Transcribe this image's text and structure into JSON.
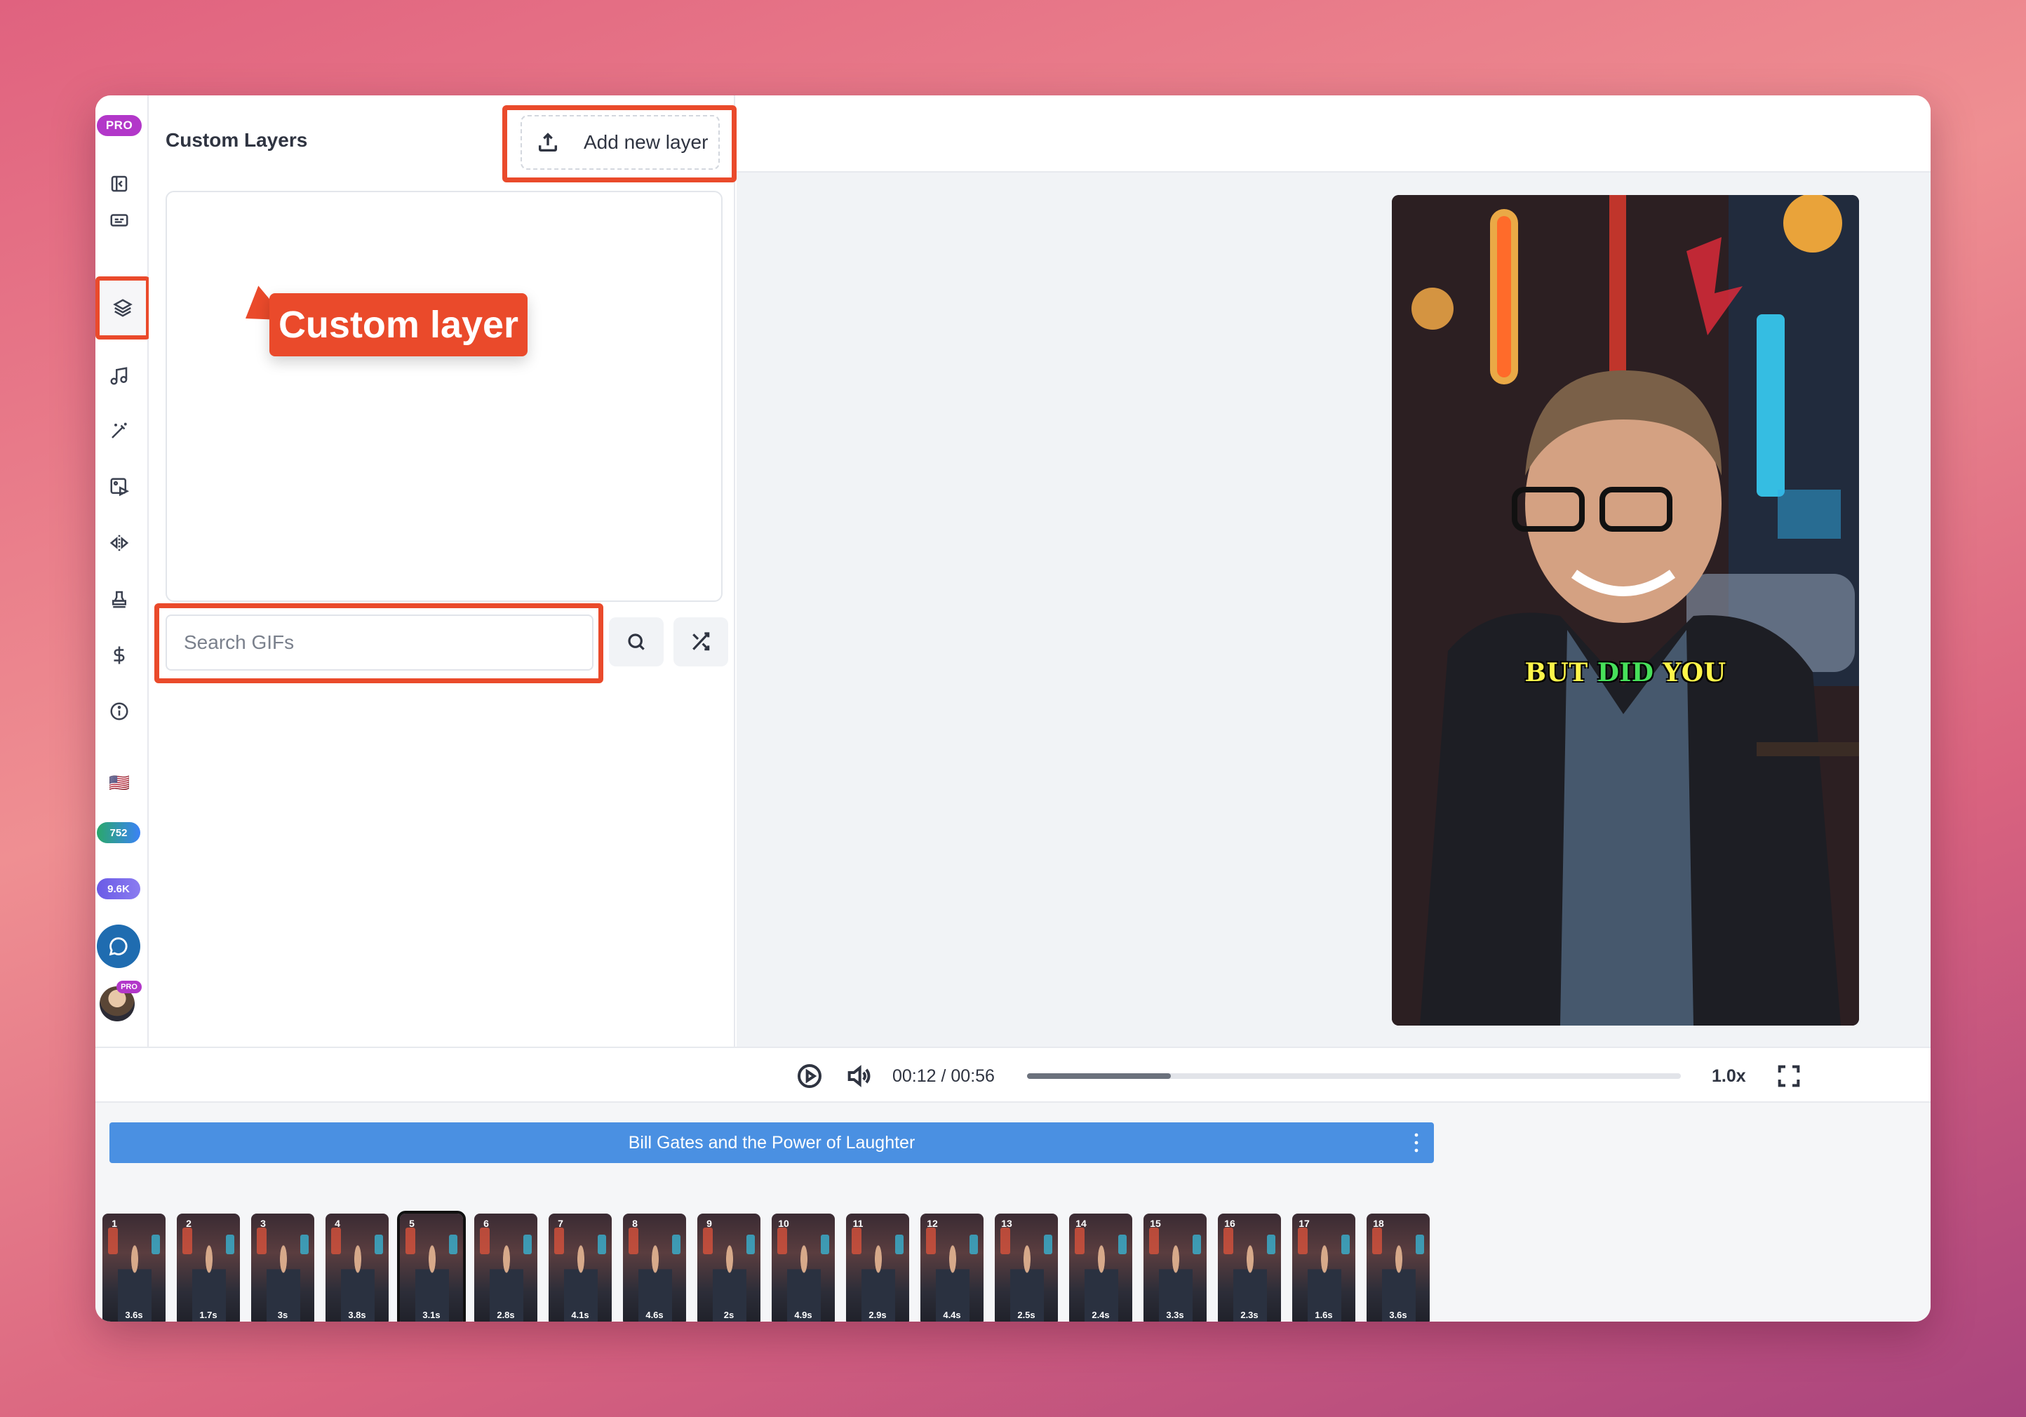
{
  "left_rail": {
    "pro_badge": "PRO",
    "icons": [
      "sidebar-toggle-icon",
      "subtitles-icon",
      "layers-icon",
      "music-note-icon",
      "magic-wand-icon",
      "image-play-icon",
      "flip-icon",
      "stamp-icon",
      "dollar-icon",
      "info-icon"
    ],
    "language_flag": "🇺🇸",
    "credits_badge": "752",
    "credits_badge_2": "9.6K",
    "avatar_badge": "PRO"
  },
  "panel": {
    "title": "Custom Layers",
    "add_layer_label": "Add new layer",
    "search_placeholder": "Search GIFs"
  },
  "callout": {
    "label": "Custom layer"
  },
  "video": {
    "caption_words": [
      "BUT",
      "DID",
      "YOU"
    ]
  },
  "controls": {
    "time": "00:12 / 00:56",
    "progress_fraction": 0.22,
    "speed": "1.0x"
  },
  "timeline": {
    "title": "Bill Gates and the Power of Laughter",
    "selected_index": 5,
    "clips": [
      {
        "num": "1",
        "dur": "3.6s"
      },
      {
        "num": "2",
        "dur": "1.7s"
      },
      {
        "num": "3",
        "dur": "3s"
      },
      {
        "num": "4",
        "dur": "3.8s"
      },
      {
        "num": "5",
        "dur": "3.1s"
      },
      {
        "num": "6",
        "dur": "2.8s"
      },
      {
        "num": "7",
        "dur": "4.1s"
      },
      {
        "num": "8",
        "dur": "4.6s"
      },
      {
        "num": "9",
        "dur": "2s"
      },
      {
        "num": "10",
        "dur": "4.9s"
      },
      {
        "num": "11",
        "dur": "2.9s"
      },
      {
        "num": "12",
        "dur": "4.4s"
      },
      {
        "num": "13",
        "dur": "2.5s"
      },
      {
        "num": "14",
        "dur": "2.4s"
      },
      {
        "num": "15",
        "dur": "3.3s"
      },
      {
        "num": "16",
        "dur": "2.3s"
      },
      {
        "num": "17",
        "dur": "1.6s"
      },
      {
        "num": "18",
        "dur": "3.6s"
      }
    ]
  },
  "colors": {
    "accent_red": "#ea4a2b",
    "title_bar_blue": "#4a90e2",
    "pro_purple": "#b237c9"
  }
}
